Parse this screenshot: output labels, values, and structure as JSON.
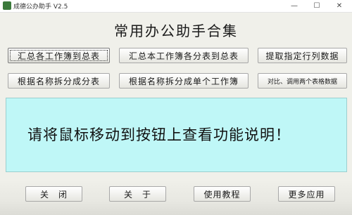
{
  "window": {
    "title": "成德公办助手 V2.5",
    "minimize_glyph": "—",
    "maximize_glyph": "☐",
    "close_glyph": "✕"
  },
  "heading": "常用办公助手合集",
  "buttons": {
    "merge_workbooks": "汇总各工作簿到总表",
    "merge_sheets": "汇总本工作簿各分表到总表",
    "extract_rows_cols": "提取指定行列数据",
    "split_by_name": "根据名称拆分成分表",
    "split_to_workbooks": "根据名称拆分成单个工作簿",
    "compare_tables": "对比、调用两个表格数据"
  },
  "info_text": "请将鼠标移动到按钮上查看功能说明！",
  "bottom_buttons": {
    "close": "关　闭",
    "about": "关　于",
    "tutorial": "使用教程",
    "more_apps": "更多应用"
  },
  "colors": {
    "info_panel_bg": "#bff7f7",
    "window_bg": "#f0f0ea"
  }
}
